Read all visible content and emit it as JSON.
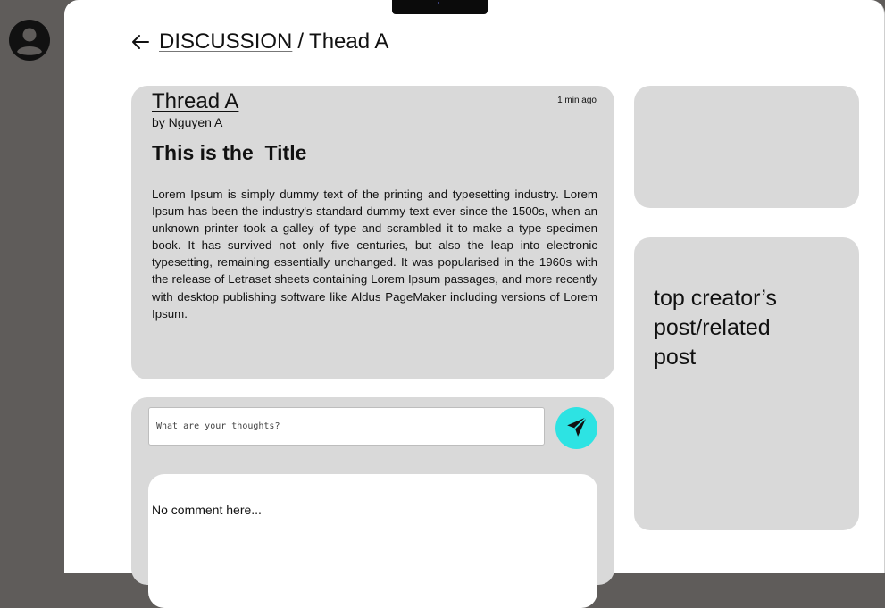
{
  "breadcrumb": {
    "parent": "DISCUSSION",
    "separator": "/",
    "current": "Thead A"
  },
  "thread": {
    "title": "Thread A",
    "author": "by Nguyen A",
    "time": "1 min ago",
    "post_title": "This is the  Title",
    "body": "Lorem Ipsum is simply dummy text of the printing and typesetting industry. Lorem Ipsum has been the industry's standard dummy text ever since the 1500s, when an unknown printer took a galley of type and scrambled it to make a type specimen book. It has survived not only five centuries, but also the leap into electronic typesetting, remaining essentially unchanged. It was popularised in the 1960s with the release of Letraset sheets containing Lorem Ipsum passages, and more recently with desktop publishing software like Aldus PageMaker including versions of Lorem Ipsum."
  },
  "comment": {
    "placeholder": "What are your thoughts?",
    "value": "",
    "send_icon": "send-icon",
    "empty_text": "No comment here..."
  },
  "sidebar": {
    "related_text": "top creator’s post/related post"
  },
  "colors": {
    "sidebar_bg": "#5f5c5a",
    "card_bg": "#d9d9d9",
    "send_button": "#2de3e3"
  },
  "icons": {
    "avatar": "user-avatar-icon",
    "back": "arrow-left-icon"
  }
}
